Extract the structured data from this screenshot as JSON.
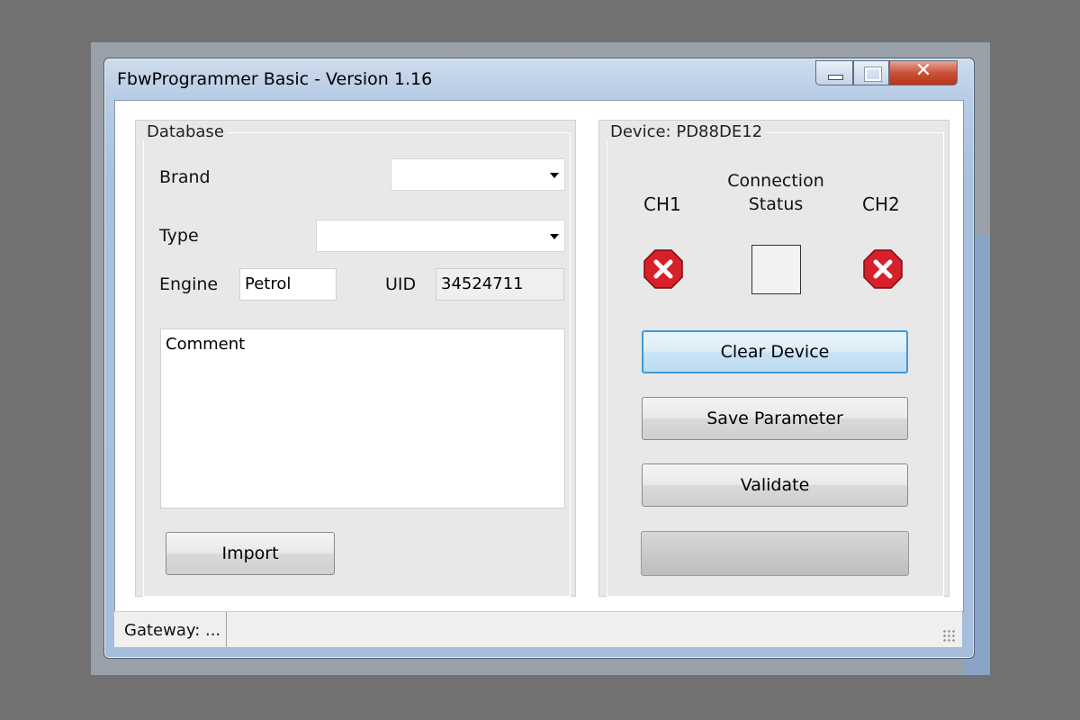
{
  "window": {
    "title": "FbwProgrammer Basic - Version 1.16"
  },
  "database": {
    "legend": "Database",
    "brand_label": "Brand",
    "brand_value": "",
    "type_label": "Type",
    "type_value": "",
    "engine_label": "Engine",
    "engine_value": "Petrol",
    "uid_label": "UID",
    "uid_value": "34524711",
    "comment_placeholder": "Comment",
    "import_label": "Import"
  },
  "device": {
    "legend": "Device:  PD88DE12",
    "ch1_label": "CH1",
    "ch2_label": "CH2",
    "connection_label_1": "Connection",
    "connection_label_2": "Status",
    "ch1_status_icon": "error-icon",
    "ch2_status_icon": "error-icon",
    "clear_label": "Clear Device",
    "save_label": "Save Parameter",
    "validate_label": "Validate",
    "disabled_label": ""
  },
  "statusbar": {
    "gateway": "Gateway: ..."
  },
  "colors": {
    "error_red": "#d8202a",
    "focus_blue": "#3c9bd9",
    "panel_gray": "#e8e8e8"
  }
}
